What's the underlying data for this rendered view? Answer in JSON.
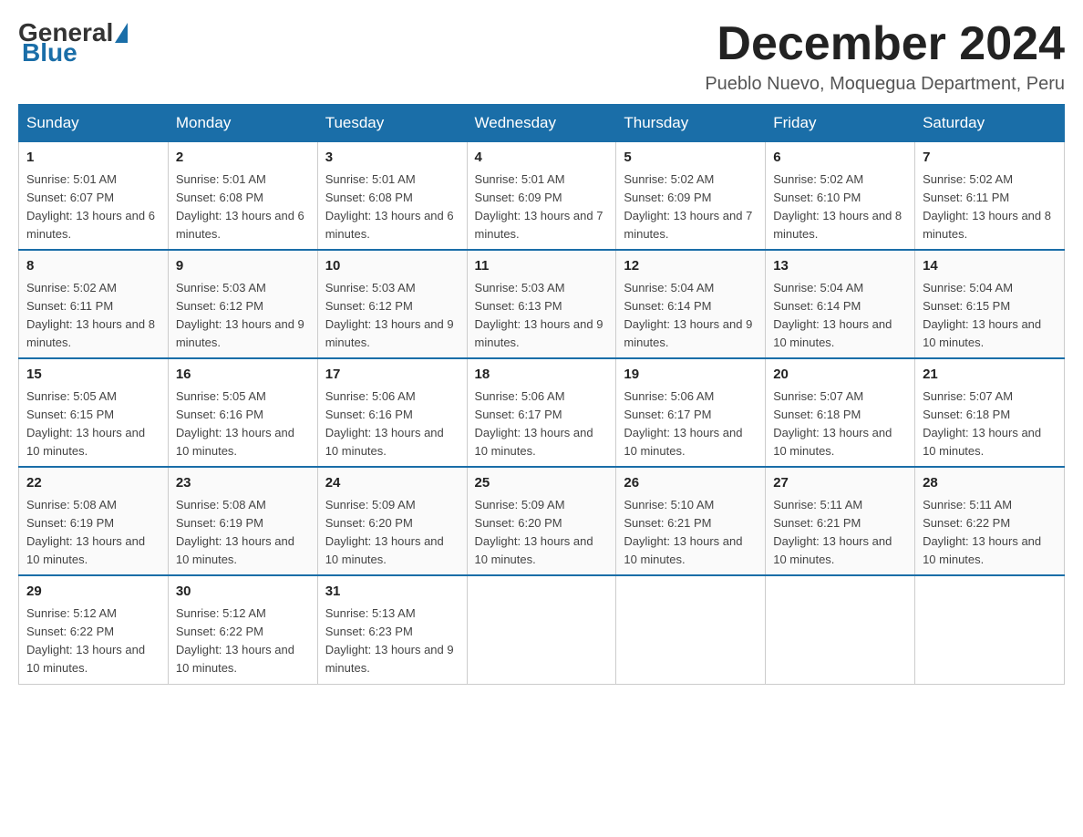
{
  "logo": {
    "general": "General",
    "blue": "Blue"
  },
  "title": "December 2024",
  "location": "Pueblo Nuevo, Moquegua Department, Peru",
  "weekdays": [
    "Sunday",
    "Monday",
    "Tuesday",
    "Wednesday",
    "Thursday",
    "Friday",
    "Saturday"
  ],
  "weeks": [
    [
      {
        "day": "1",
        "sunrise": "5:01 AM",
        "sunset": "6:07 PM",
        "daylight": "13 hours and 6 minutes."
      },
      {
        "day": "2",
        "sunrise": "5:01 AM",
        "sunset": "6:08 PM",
        "daylight": "13 hours and 6 minutes."
      },
      {
        "day": "3",
        "sunrise": "5:01 AM",
        "sunset": "6:08 PM",
        "daylight": "13 hours and 6 minutes."
      },
      {
        "day": "4",
        "sunrise": "5:01 AM",
        "sunset": "6:09 PM",
        "daylight": "13 hours and 7 minutes."
      },
      {
        "day": "5",
        "sunrise": "5:02 AM",
        "sunset": "6:09 PM",
        "daylight": "13 hours and 7 minutes."
      },
      {
        "day": "6",
        "sunrise": "5:02 AM",
        "sunset": "6:10 PM",
        "daylight": "13 hours and 8 minutes."
      },
      {
        "day": "7",
        "sunrise": "5:02 AM",
        "sunset": "6:11 PM",
        "daylight": "13 hours and 8 minutes."
      }
    ],
    [
      {
        "day": "8",
        "sunrise": "5:02 AM",
        "sunset": "6:11 PM",
        "daylight": "13 hours and 8 minutes."
      },
      {
        "day": "9",
        "sunrise": "5:03 AM",
        "sunset": "6:12 PM",
        "daylight": "13 hours and 9 minutes."
      },
      {
        "day": "10",
        "sunrise": "5:03 AM",
        "sunset": "6:12 PM",
        "daylight": "13 hours and 9 minutes."
      },
      {
        "day": "11",
        "sunrise": "5:03 AM",
        "sunset": "6:13 PM",
        "daylight": "13 hours and 9 minutes."
      },
      {
        "day": "12",
        "sunrise": "5:04 AM",
        "sunset": "6:14 PM",
        "daylight": "13 hours and 9 minutes."
      },
      {
        "day": "13",
        "sunrise": "5:04 AM",
        "sunset": "6:14 PM",
        "daylight": "13 hours and 10 minutes."
      },
      {
        "day": "14",
        "sunrise": "5:04 AM",
        "sunset": "6:15 PM",
        "daylight": "13 hours and 10 minutes."
      }
    ],
    [
      {
        "day": "15",
        "sunrise": "5:05 AM",
        "sunset": "6:15 PM",
        "daylight": "13 hours and 10 minutes."
      },
      {
        "day": "16",
        "sunrise": "5:05 AM",
        "sunset": "6:16 PM",
        "daylight": "13 hours and 10 minutes."
      },
      {
        "day": "17",
        "sunrise": "5:06 AM",
        "sunset": "6:16 PM",
        "daylight": "13 hours and 10 minutes."
      },
      {
        "day": "18",
        "sunrise": "5:06 AM",
        "sunset": "6:17 PM",
        "daylight": "13 hours and 10 minutes."
      },
      {
        "day": "19",
        "sunrise": "5:06 AM",
        "sunset": "6:17 PM",
        "daylight": "13 hours and 10 minutes."
      },
      {
        "day": "20",
        "sunrise": "5:07 AM",
        "sunset": "6:18 PM",
        "daylight": "13 hours and 10 minutes."
      },
      {
        "day": "21",
        "sunrise": "5:07 AM",
        "sunset": "6:18 PM",
        "daylight": "13 hours and 10 minutes."
      }
    ],
    [
      {
        "day": "22",
        "sunrise": "5:08 AM",
        "sunset": "6:19 PM",
        "daylight": "13 hours and 10 minutes."
      },
      {
        "day": "23",
        "sunrise": "5:08 AM",
        "sunset": "6:19 PM",
        "daylight": "13 hours and 10 minutes."
      },
      {
        "day": "24",
        "sunrise": "5:09 AM",
        "sunset": "6:20 PM",
        "daylight": "13 hours and 10 minutes."
      },
      {
        "day": "25",
        "sunrise": "5:09 AM",
        "sunset": "6:20 PM",
        "daylight": "13 hours and 10 minutes."
      },
      {
        "day": "26",
        "sunrise": "5:10 AM",
        "sunset": "6:21 PM",
        "daylight": "13 hours and 10 minutes."
      },
      {
        "day": "27",
        "sunrise": "5:11 AM",
        "sunset": "6:21 PM",
        "daylight": "13 hours and 10 minutes."
      },
      {
        "day": "28",
        "sunrise": "5:11 AM",
        "sunset": "6:22 PM",
        "daylight": "13 hours and 10 minutes."
      }
    ],
    [
      {
        "day": "29",
        "sunrise": "5:12 AM",
        "sunset": "6:22 PM",
        "daylight": "13 hours and 10 minutes."
      },
      {
        "day": "30",
        "sunrise": "5:12 AM",
        "sunset": "6:22 PM",
        "daylight": "13 hours and 10 minutes."
      },
      {
        "day": "31",
        "sunrise": "5:13 AM",
        "sunset": "6:23 PM",
        "daylight": "13 hours and 9 minutes."
      },
      null,
      null,
      null,
      null
    ]
  ],
  "labels": {
    "sunrise_prefix": "Sunrise: ",
    "sunset_prefix": "Sunset: ",
    "daylight_prefix": "Daylight: "
  }
}
